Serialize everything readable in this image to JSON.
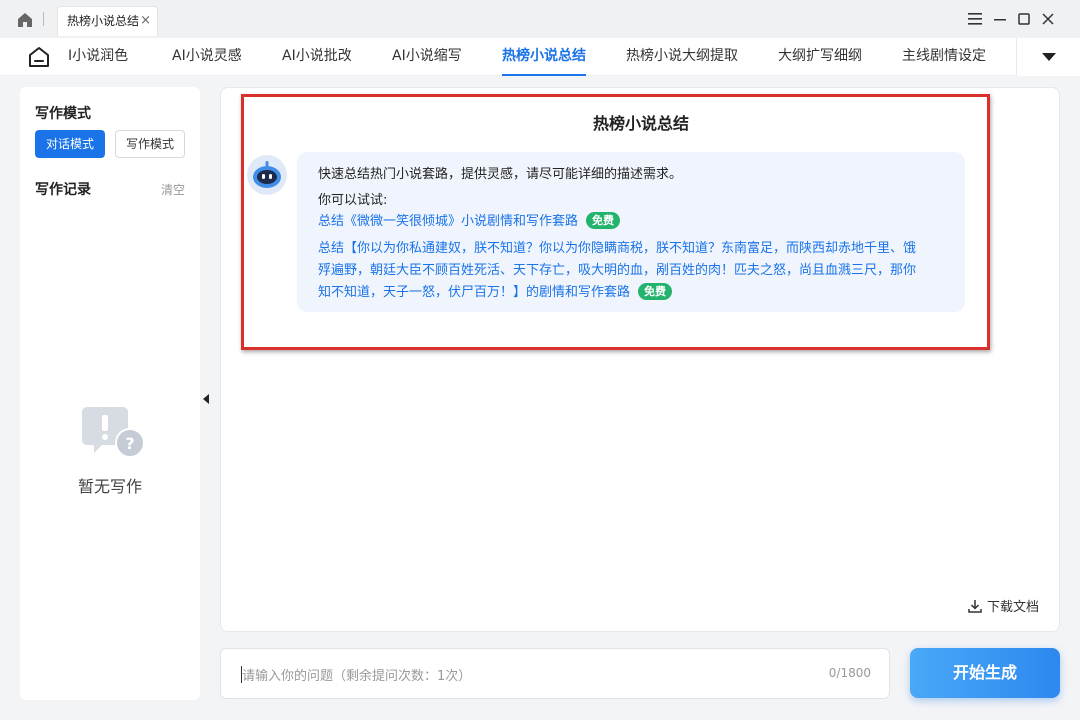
{
  "titlebar": {
    "tab_label": "热榜小说总结",
    "tab_close": "×"
  },
  "nav": {
    "items": [
      {
        "label": "I小说润色",
        "active": false
      },
      {
        "label": "AI小说灵感",
        "active": false
      },
      {
        "label": "AI小说批改",
        "active": false
      },
      {
        "label": "AI小说缩写",
        "active": false
      },
      {
        "label": "热榜小说总结",
        "active": true
      },
      {
        "label": "热榜小说大纲提取",
        "active": false
      },
      {
        "label": "大纲扩写细纲",
        "active": false
      },
      {
        "label": "主线剧情设定",
        "active": false
      }
    ]
  },
  "sidebar": {
    "mode_title": "写作模式",
    "mode_dialog": "对话模式",
    "mode_write": "写作模式",
    "records_title": "写作记录",
    "clear_label": "清空",
    "empty_text": "暂无写作"
  },
  "main": {
    "title": "热榜小说总结",
    "intro": "快速总结热门小说套路，提供灵感，请尽可能详细的描述需求。",
    "try_label": "你可以试试:",
    "examples": [
      {
        "text": "总结《微微一笑很倾城》小说剧情和写作套路",
        "badge": "免费"
      },
      {
        "text": "总结【你以为你私通建奴，朕不知道？你以为你隐瞒商税，朕不知道？东南富足，而陕西却赤地千里、饿殍遍野，朝廷大臣不顾百姓死活、天下存亡，吸大明的血，剐百姓的肉！匹夫之怒，尚且血溅三尺，那你知不知道，天子一怒，伏尸百万！】的剧情和写作套路",
        "badge": "免费"
      }
    ],
    "download_label": "下载文档"
  },
  "input": {
    "placeholder": "请输入你的问题（剩余提问次数：1次）",
    "count": "0/1800"
  },
  "generate_label": "开始生成",
  "colors": {
    "accent": "#1a73e8",
    "free_badge": "#23b36d",
    "highlight_border": "#d9302c"
  }
}
